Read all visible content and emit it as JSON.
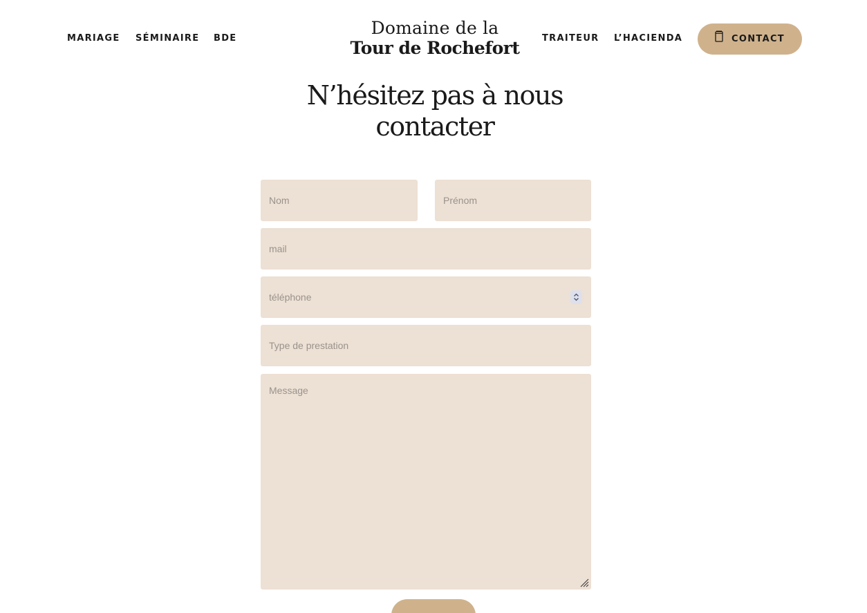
{
  "nav": {
    "left": [
      "MARIAGE",
      "SÉMINAIRE",
      "BDE"
    ],
    "right": [
      "TRAITEUR",
      "L’HACIENDA"
    ],
    "contact_label": "CONTACT"
  },
  "logo": {
    "line1": "Domaine de la",
    "line2": "Tour de Rochefort"
  },
  "heading": {
    "line1": "N’hésitez pas à nous",
    "line2": "contacter"
  },
  "form": {
    "nom_placeholder": "Nom",
    "prenom_placeholder": "Prénom",
    "mail_placeholder": "mail",
    "telephone_placeholder": "téléphone",
    "prestation_placeholder": "Type de prestation",
    "message_placeholder": "Message",
    "submit_label": ""
  },
  "colors": {
    "accent": "#cfb28c",
    "field_bg": "#ede0d4",
    "text": "#1a1a1a",
    "placeholder": "#9a938c"
  },
  "icons": {
    "contact": "phone-book-icon",
    "telephone_spinner": "number-spinner-icon",
    "message_resize": "resize-grip-icon"
  }
}
